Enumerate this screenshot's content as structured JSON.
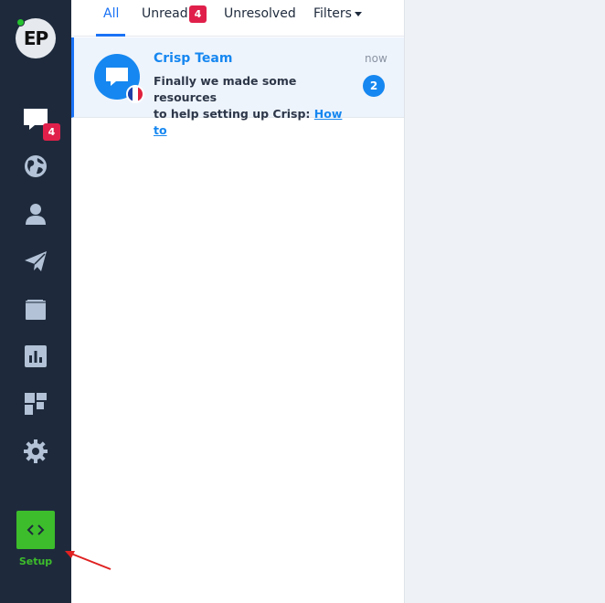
{
  "sidebar": {
    "logo_text": "EP",
    "nav_badge": "4",
    "setup_label": "Setup",
    "icons": [
      "chat-icon",
      "globe-icon",
      "user-icon",
      "send-icon",
      "book-icon",
      "chart-icon",
      "plugins-icon",
      "gear-icon"
    ]
  },
  "tabs": {
    "all": "All",
    "unread": "Unread",
    "unread_count": "4",
    "unresolved": "Unresolved",
    "filters": "Filters"
  },
  "conversation": {
    "name": "Crisp Team",
    "time": "now",
    "message_line1": "Finally we made some resources",
    "message_line2": "to help setting up Crisp:",
    "link_text": "How to",
    "unread_count": "2",
    "flag": "France"
  },
  "colors": {
    "sidebar_bg": "#1e2a3c",
    "accent": "#1972f5",
    "badge": "#e0204a",
    "setup_green": "#3dbd2b"
  }
}
